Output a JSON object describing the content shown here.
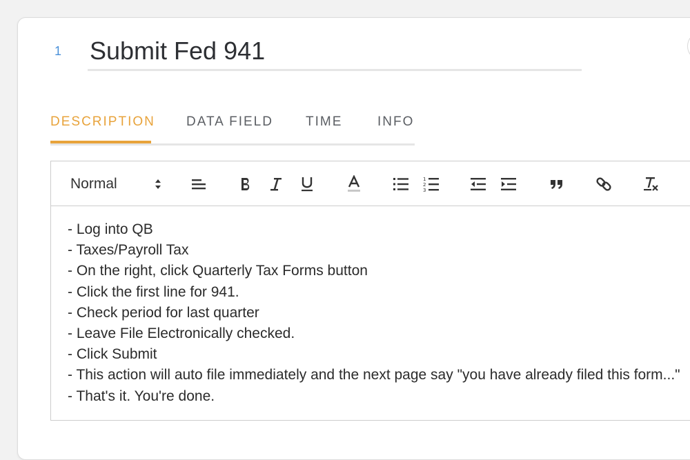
{
  "task": {
    "number": "1",
    "title": "Submit Fed 941"
  },
  "tabs": [
    {
      "label": "DESCRIPTION",
      "active": true
    },
    {
      "label": "DATA FIELD",
      "active": false
    },
    {
      "label": "TIME",
      "active": false
    },
    {
      "label": "INFO",
      "active": false
    }
  ],
  "toolbar": {
    "format_select": "Normal",
    "buttons": [
      "align-icon",
      "bold-icon",
      "italic-icon",
      "underline-icon",
      "text-color-icon",
      "bullet-list-icon",
      "ordered-list-icon",
      "outdent-icon",
      "indent-icon",
      "blockquote-icon",
      "link-icon",
      "clear-format-icon"
    ]
  },
  "description_lines": [
    "- Log into QB",
    "- Taxes/Payroll Tax",
    "- On the right, click Quarterly Tax Forms button",
    "- Click the first line for 941.",
    "- Check period for last quarter",
    "- Leave File Electronically checked.",
    "- Click Submit",
    "- This action will auto file immediately and the next page say \"you have already filed this form...\"",
    "- That's it. You're done."
  ],
  "colors": {
    "accent": "#e8a33b",
    "step_number": "#4a90d9",
    "title_text": "#2d2f33"
  }
}
